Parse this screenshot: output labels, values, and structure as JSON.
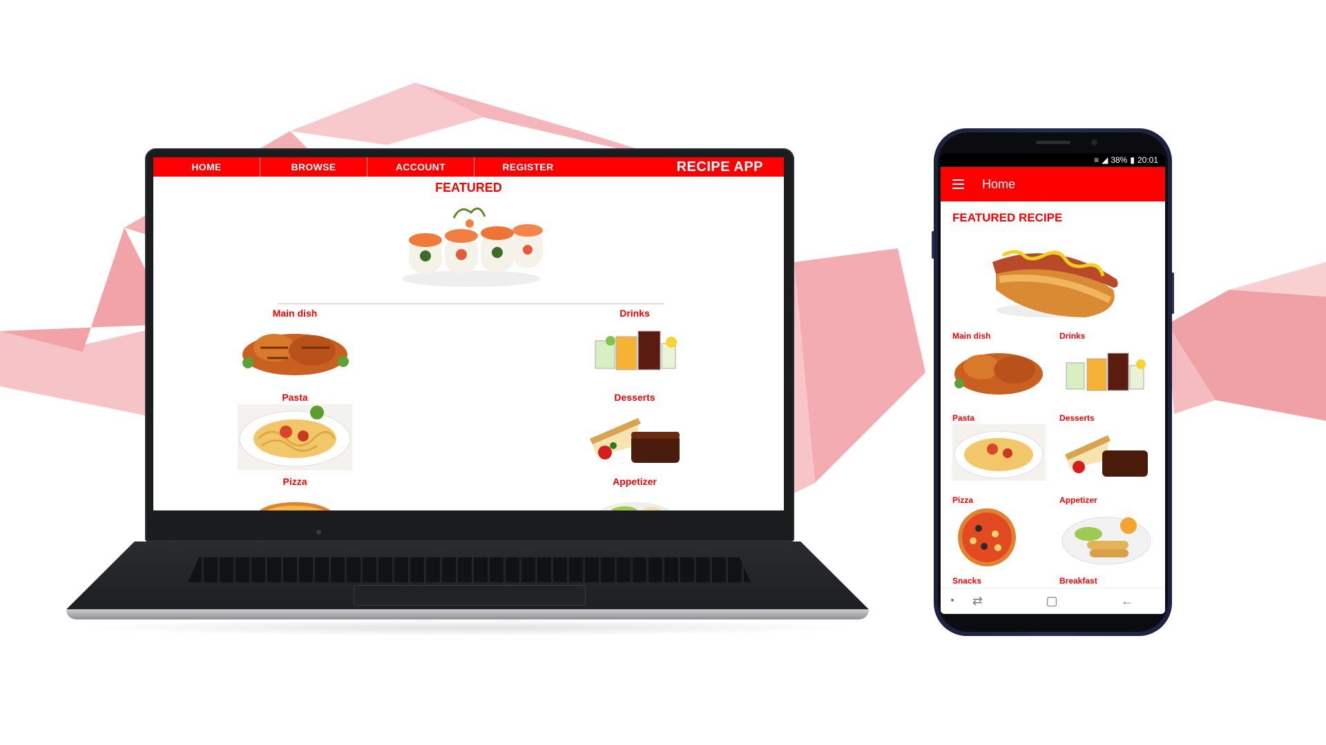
{
  "website": {
    "nav": [
      "HOME",
      "BROWSE",
      "ACCOUNT",
      "REGISTER"
    ],
    "brand": "RECIPE APP",
    "featured_title": "FEATURED",
    "categories": [
      "Main dish",
      "Drinks",
      "Pasta",
      "Desserts",
      "Pizza",
      "Appetizer"
    ]
  },
  "mobile": {
    "status": {
      "battery": "38%",
      "time": "20:01"
    },
    "app_title": "Home",
    "featured_title": "FEATURED RECIPE",
    "categories": [
      "Main dish",
      "Drinks",
      "Pasta",
      "Desserts",
      "Pizza",
      "Appetizer",
      "Snacks",
      "Breakfast"
    ]
  },
  "colors": {
    "brand_red": "#ff0000",
    "background_polygons": "#f3a3a8"
  }
}
